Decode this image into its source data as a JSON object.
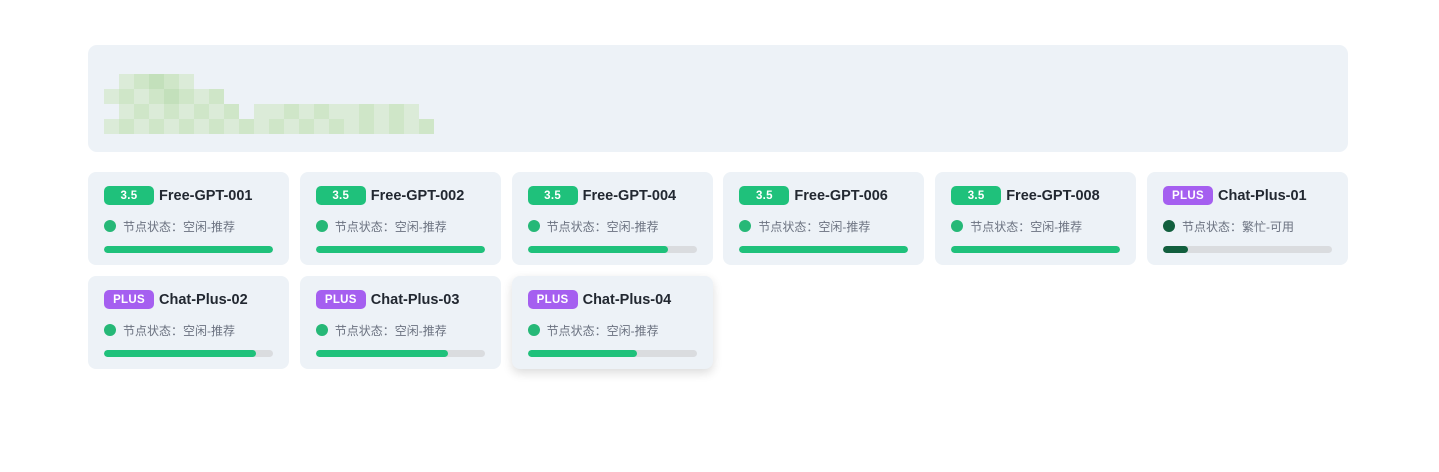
{
  "colors": {
    "page_bg": "#ffffff",
    "panel_bg": "#edf2f7",
    "badge_35": "#1fc17b",
    "badge_plus": "#a55ff0",
    "progress_idle": "#1fc17b",
    "progress_busy": "#125f3e",
    "track": "#dadcdf",
    "dot_idle": "#26b877",
    "dot_busy": "#125f3e"
  },
  "nodes": [
    {
      "badge": "3.5",
      "tier": "b35",
      "name": "Free-GPT-001",
      "status": "节点状态：空闲-推荐",
      "state": "idle",
      "load": 1.0
    },
    {
      "badge": "3.5",
      "tier": "b35",
      "name": "Free-GPT-002",
      "status": "节点状态：空闲-推荐",
      "state": "idle",
      "load": 1.0
    },
    {
      "badge": "3.5",
      "tier": "b35",
      "name": "Free-GPT-004",
      "status": "节点状态：空闲-推荐",
      "state": "idle",
      "load": 0.83
    },
    {
      "badge": "3.5",
      "tier": "b35",
      "name": "Free-GPT-006",
      "status": "节点状态：空闲-推荐",
      "state": "idle",
      "load": 1.0
    },
    {
      "badge": "3.5",
      "tier": "b35",
      "name": "Free-GPT-008",
      "status": "节点状态：空闲-推荐",
      "state": "idle",
      "load": 1.0
    },
    {
      "badge": "PLUS",
      "tier": "plus",
      "name": "Chat-Plus-01",
      "status": "节点状态：繁忙-可用",
      "state": "busy",
      "load": 0.15
    },
    {
      "badge": "PLUS",
      "tier": "plus",
      "name": "Chat-Plus-02",
      "status": "节点状态：空闲-推荐",
      "state": "idle",
      "load": 0.9
    },
    {
      "badge": "PLUS",
      "tier": "plus",
      "name": "Chat-Plus-03",
      "status": "节点状态：空闲-推荐",
      "state": "idle",
      "load": 0.78
    },
    {
      "badge": "PLUS",
      "tier": "plus",
      "name": "Chat-Plus-04",
      "status": "节点状态：空闲-推荐",
      "state": "idle",
      "load": 0.65,
      "hovered": true
    }
  ]
}
